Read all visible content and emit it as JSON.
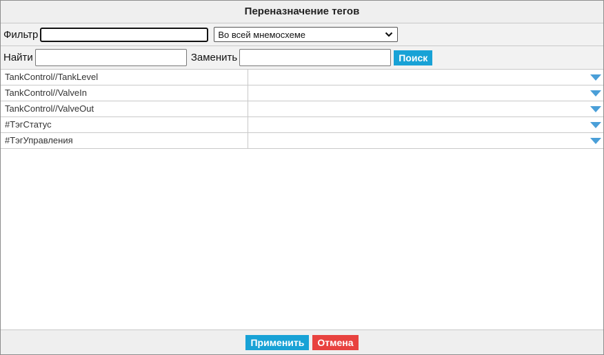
{
  "dialog": {
    "title": "Переназначение тегов"
  },
  "filter": {
    "label": "Фильтр",
    "value": "",
    "scope_selected": "Во всей мнемосхеме"
  },
  "search": {
    "find_label": "Найти",
    "find_value": "",
    "replace_label": "Заменить",
    "replace_value": "",
    "search_button": "Поиск"
  },
  "tags": [
    {
      "name": "TankControl//TankLevel",
      "target": ""
    },
    {
      "name": "TankControl//ValveIn",
      "target": ""
    },
    {
      "name": "TankControl//ValveOut",
      "target": ""
    },
    {
      "name": "#ТэгСтатус",
      "target": ""
    },
    {
      "name": "#ТэгУправления",
      "target": ""
    }
  ],
  "footer": {
    "apply_button": "Применить",
    "cancel_button": "Отмена"
  },
  "colors": {
    "accent_blue": "#18a2d6",
    "cancel_red": "#e8423f",
    "dropdown_arrow": "#4a9fd8"
  },
  "icons": {
    "scope_chevron": "chevron-down-icon",
    "row_dropdown": "triangle-down-icon"
  }
}
